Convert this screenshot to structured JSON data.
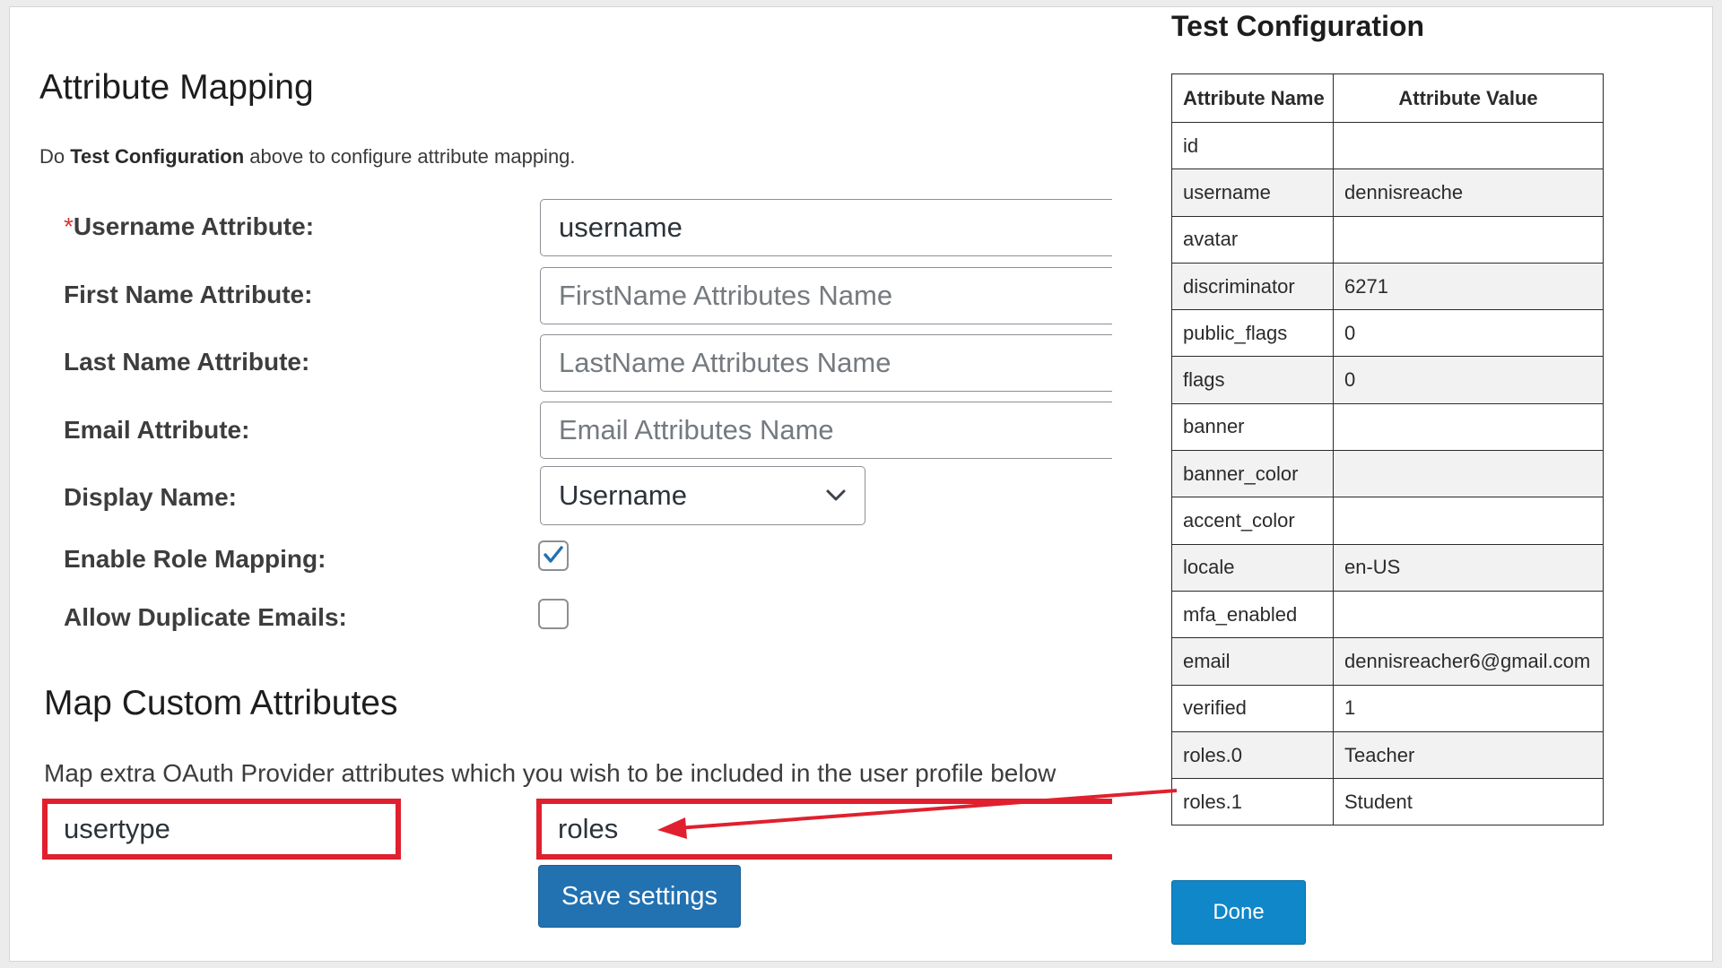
{
  "mapping": {
    "title": "Attribute Mapping",
    "desc_prefix": "Do ",
    "desc_bold": "Test Configuration",
    "desc_suffix": " above to configure attribute mapping.",
    "required_mark": "*",
    "username_label": "Username Attribute:",
    "username_value": "username",
    "firstname_label": "First Name Attribute:",
    "firstname_placeholder": "FirstName Attributes Name",
    "lastname_label": "Last Name Attribute:",
    "lastname_placeholder": "LastName Attributes Name",
    "email_label": "Email Attribute:",
    "email_placeholder": "Email Attributes Name",
    "display_label": "Display Name:",
    "display_value": "Username",
    "role_label": "Enable Role Mapping:",
    "role_checked": true,
    "dup_label": "Allow Duplicate Emails:",
    "dup_checked": false
  },
  "custom": {
    "title": "Map Custom Attributes",
    "desc": "Map extra OAuth Provider attributes which you wish to be included in the user profile below",
    "key_value": "usertype",
    "attr_value": "roles",
    "save_label": "Save settings",
    "highlight_color": "#e0202e"
  },
  "test_config": {
    "title": "Test Configuration",
    "col_name": "Attribute Name",
    "col_value": "Attribute Value",
    "rows": [
      [
        "id",
        ""
      ],
      [
        "username",
        "dennisreache"
      ],
      [
        "avatar",
        ""
      ],
      [
        "discriminator",
        "6271"
      ],
      [
        "public_flags",
        "0"
      ],
      [
        "flags",
        "0"
      ],
      [
        "banner",
        ""
      ],
      [
        "banner_color",
        ""
      ],
      [
        "accent_color",
        ""
      ],
      [
        "locale",
        "en-US"
      ],
      [
        "mfa_enabled",
        ""
      ],
      [
        "email",
        "dennisreacher6@gmail.com"
      ],
      [
        "verified",
        "1"
      ],
      [
        "roles.0",
        "Teacher"
      ],
      [
        "roles.1",
        "Student"
      ]
    ],
    "done_label": "Done"
  }
}
